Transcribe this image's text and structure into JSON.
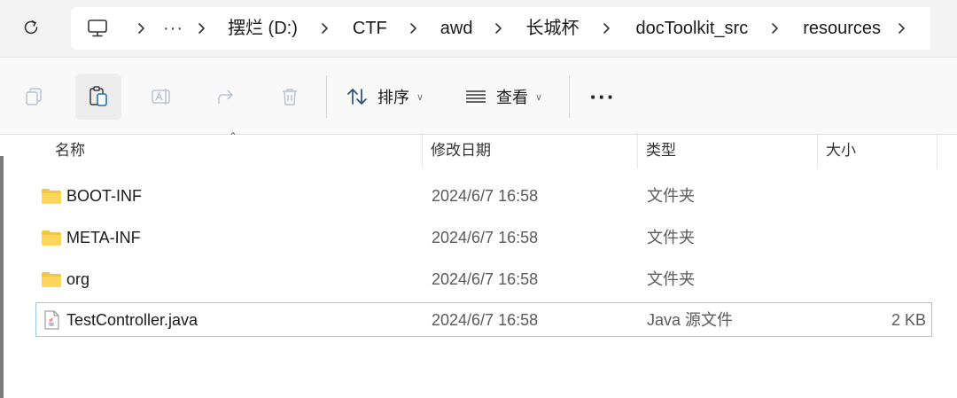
{
  "address_bar": {
    "crumbs": [
      "摆烂 (D:)",
      "CTF",
      "awd",
      "长城杯",
      "docToolkit_src",
      "resources"
    ],
    "overflow": "···"
  },
  "commands": {
    "sort_label": "排序",
    "view_label": "查看",
    "more": "···"
  },
  "columns": {
    "name": "名称",
    "modified": "修改日期",
    "type": "类型",
    "size": "大小"
  },
  "files": [
    {
      "name": "BOOT-INF",
      "modified": "2024/6/7 16:58",
      "type": "文件夹",
      "size": "",
      "icon": "folder-icon"
    },
    {
      "name": "META-INF",
      "modified": "2024/6/7 16:58",
      "type": "文件夹",
      "size": "",
      "icon": "folder-icon"
    },
    {
      "name": "org",
      "modified": "2024/6/7 16:58",
      "type": "文件夹",
      "size": "",
      "icon": "folder-icon"
    },
    {
      "name": "TestController.java",
      "modified": "2024/6/7 16:58",
      "type": "Java 源文件",
      "size": "2 KB",
      "icon": "java-file-icon",
      "selected": true
    }
  ],
  "colors": {
    "folder": "#f4c542",
    "selection_border": "#99c9ef"
  }
}
